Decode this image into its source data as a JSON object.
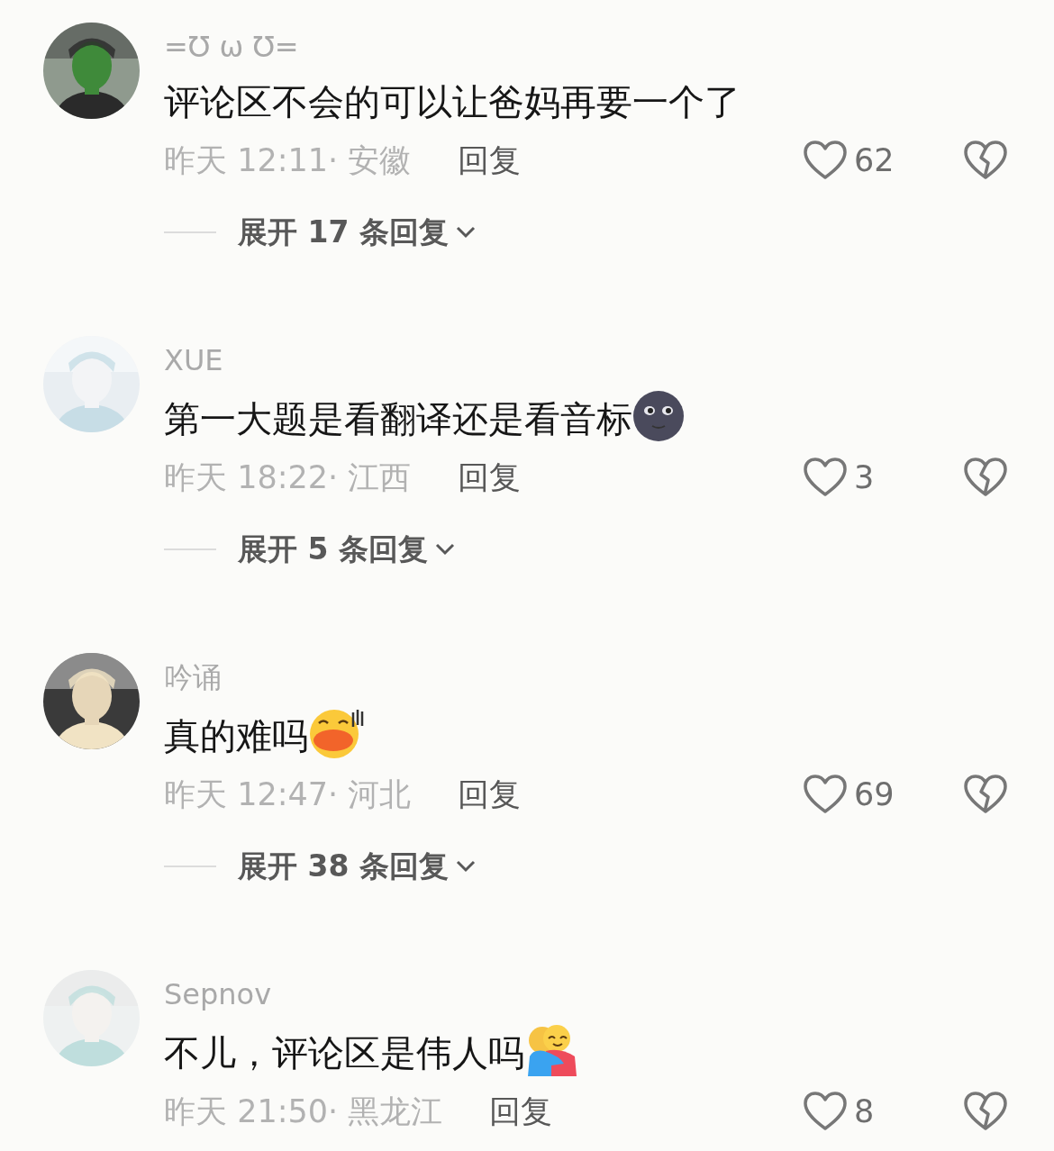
{
  "comments": [
    {
      "username": "=Ʊ ω Ʊ=",
      "text": "评论区不会的可以让爸妈再要一个了",
      "time_location": "昨天 12:11· 安徽",
      "reply": "回复",
      "likes": "62",
      "expand": "展开 17 条回复"
    },
    {
      "username": "XUE",
      "text": "第一大题是看翻译还是看音标",
      "emoji": {
        "kind": "moon"
      },
      "time_location": "昨天 18:22· 江西",
      "reply": "回复",
      "likes": "3",
      "expand": "展开 5 条回复"
    },
    {
      "username": "吟诵",
      "text": "真的难吗",
      "emoji": {
        "kind": "duck"
      },
      "time_location": "昨天 12:47· 河北",
      "reply": "回复",
      "likes": "69",
      "expand": "展开 38 条回复"
    },
    {
      "username": "Sepnov",
      "text": "不儿，评论区是伟人吗",
      "emoji": {
        "kind": "hug"
      },
      "time_location": "昨天 21:50· 黑龙江",
      "reply": "回复",
      "likes": "8"
    }
  ]
}
